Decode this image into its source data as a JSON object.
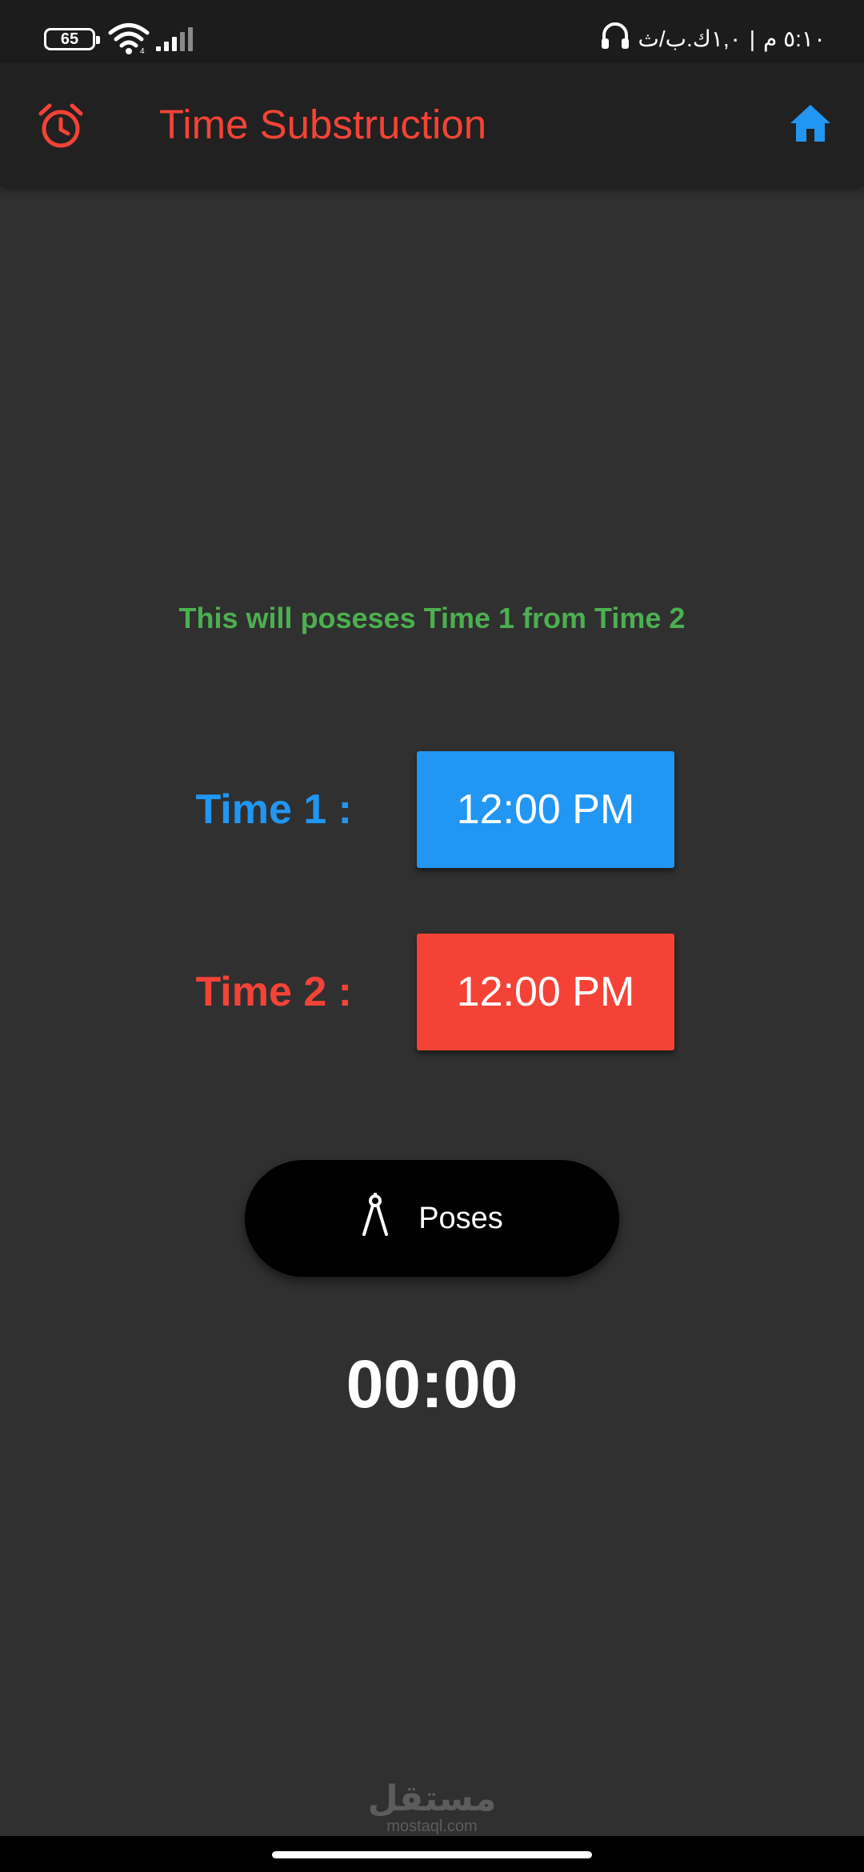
{
  "status_bar": {
    "battery_level": "65",
    "carrier_text": "١,٠ك.ب/ث",
    "separator": "|",
    "time": "٥:١٠ م",
    "icons": [
      "wifi-icon",
      "signal-icon",
      "headphones-icon"
    ]
  },
  "app_bar": {
    "title": "Time Substruction",
    "leading_icon": "alarm-icon",
    "trailing_icon": "home-icon"
  },
  "main": {
    "description": "This will poseses Time 1 from Time 2",
    "time1": {
      "label": "Time 1 :",
      "value": "12:00 PM"
    },
    "time2": {
      "label": "Time 2 :",
      "value": "12:00 PM"
    },
    "poses_button": {
      "label": "Poses",
      "icon": "compass-icon"
    },
    "result": "00:00"
  },
  "watermark": {
    "logo": "مستقل",
    "url": "mostaql.com"
  },
  "colors": {
    "accent_red": "#f44336",
    "accent_blue": "#2196f3",
    "accent_green": "#4caf50",
    "background": "#303030",
    "app_bar": "#212121"
  }
}
